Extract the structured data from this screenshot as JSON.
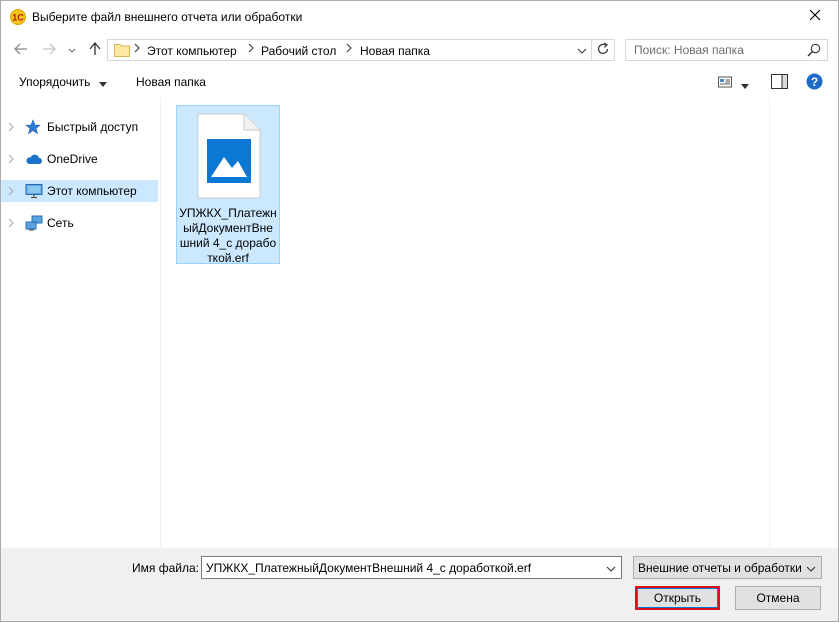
{
  "window": {
    "title": "Выберите файл внешнего отчета или обработки",
    "app_icon": "1c-icon",
    "close_icon": "close-icon"
  },
  "address": {
    "crumbs": [
      "Этот компьютер",
      "Рабочий стол",
      "Новая папка"
    ],
    "separator": ">"
  },
  "search": {
    "placeholder": "Поиск: Новая папка"
  },
  "toolbar": {
    "organize_label": "Упорядочить",
    "new_folder_label": "Новая папка"
  },
  "sidebar": {
    "items": [
      {
        "label": "Быстрый доступ",
        "icon": "star-icon",
        "selected": false
      },
      {
        "label": "OneDrive",
        "icon": "cloud-icon",
        "selected": false
      },
      {
        "label": "Этот компьютер",
        "icon": "computer-icon",
        "selected": true
      },
      {
        "label": "Сеть",
        "icon": "network-icon",
        "selected": false
      }
    ]
  },
  "files": [
    {
      "name": "УПЖКХ_ПлатежныйДокументВнешний 4_с доработкой.erf",
      "icon": "image-file-icon",
      "selected": true
    }
  ],
  "bottom": {
    "filename_label": "Имя файла:",
    "filename_value": "УПЖКХ_ПлатежныйДокументВнешний 4_с доработкой.erf",
    "filter_value": "Внешние отчеты и обработки",
    "open_label": "Открыть",
    "cancel_label": "Отмена"
  },
  "colors": {
    "selection": "#cce8ff",
    "highlight_border": "#e0101a",
    "accent": "#0078d7"
  }
}
